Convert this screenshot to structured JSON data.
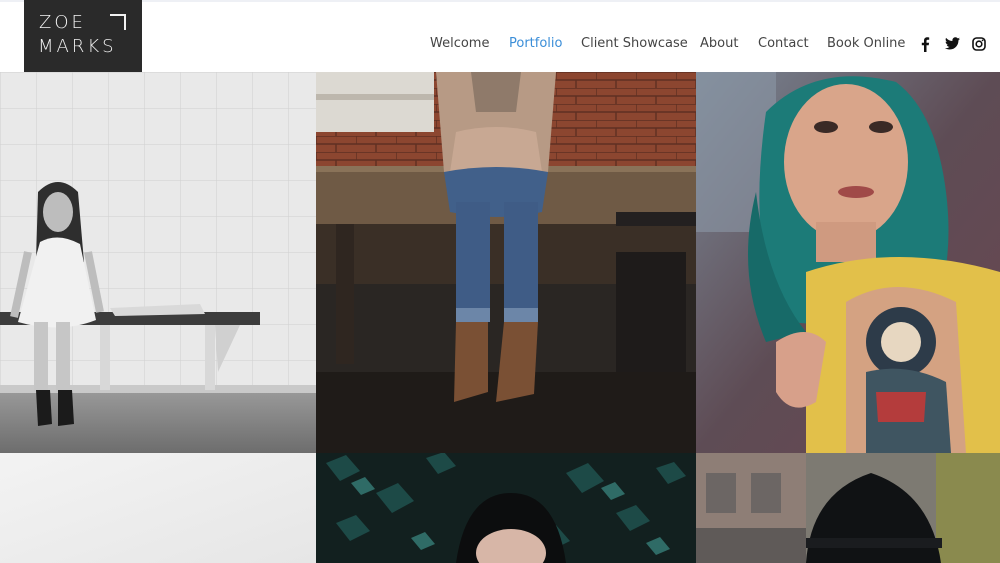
{
  "brand": {
    "line1": "ZOE",
    "line2": "MARKS"
  },
  "nav": {
    "items": [
      {
        "label": "Welcome",
        "active": false
      },
      {
        "label": "Portfolio",
        "active": true
      },
      {
        "label": "Client Showcase",
        "active": false
      },
      {
        "label": "About",
        "active": false
      },
      {
        "label": "Contact",
        "active": false
      },
      {
        "label": "Book Online",
        "active": false
      }
    ],
    "active_color": "#3b8ed8"
  },
  "social": [
    "facebook-icon",
    "twitter-icon",
    "instagram-icon"
  ],
  "gallery": {
    "photos": [
      "woman-on-bench-bw-photo",
      "woman-sitting-on-table-photo",
      "woman-teal-hair-tattoo-photo",
      "white-wall-photo",
      "woman-in-ivy-photo",
      "person-black-hat-photo"
    ]
  }
}
